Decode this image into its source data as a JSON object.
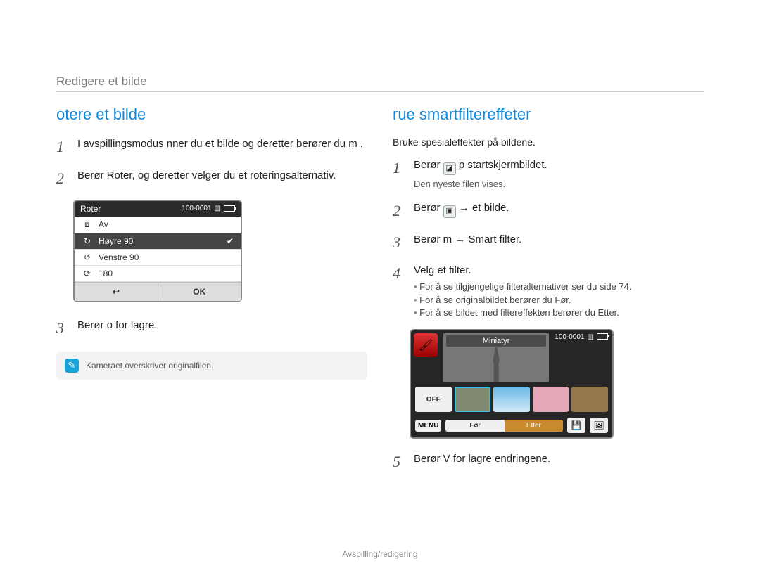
{
  "header": "Redigere et bilde",
  "footer": "Avspilling/redigering",
  "left": {
    "title": "otere et bilde",
    "steps": {
      "s1": "I avspillingsmodus  nner du et bilde og deretter berører du m .",
      "s2": "Berør Roter, og deretter velger du et roteringsalternativ.",
      "s3": "Berør o   for  lagre."
    },
    "roter": {
      "title": "Roter",
      "indicator": "100-0001",
      "row_off": "Av",
      "row_right": "Høyre 90",
      "row_left": "Venstre 90",
      "row_180": "180",
      "ok": "OK"
    },
    "note": "Kameraet overskriver originalﬁlen."
  },
  "right": {
    "title": "rue smartﬁltereffeter",
    "intro": "Bruke spesialeffekter på bildene.",
    "steps": {
      "s1a": "Berør",
      "s1b": "p  startskjermbildet.",
      "s1_sub": "Den nyeste ﬁlen vises.",
      "s2a": "Berør",
      "s2b": "→ et bilde.",
      "s3": "Berør m   → Smart ﬁlter.",
      "s4": "Velg et ﬁlter.",
      "s4_b1": "For å se tilgjengelige ﬁlteralternativer ser du side 74.",
      "s4_b2": "For å se originalbildet berører du Før.",
      "s4_b3": "For å se bildet med ﬁltereffekten berører du Etter.",
      "s5": "Berør  V   for  lagre endringene."
    },
    "ui": {
      "indicator": "100-0001",
      "mini": "Miniatyr",
      "off": "OFF",
      "menu": "MENU",
      "before": "Før",
      "after": "Etter"
    }
  }
}
